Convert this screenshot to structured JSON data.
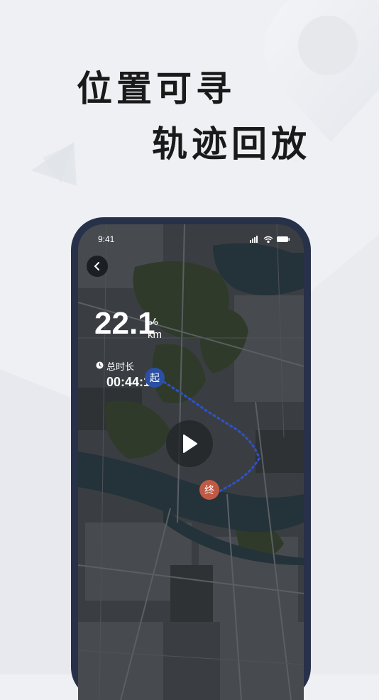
{
  "headline": {
    "line1": "位置可寻",
    "line2": "轨迹回放"
  },
  "status_bar": {
    "time": "9:41"
  },
  "trip": {
    "distance": "22.1",
    "distance_unit": "km",
    "duration_label": "总时长",
    "duration_value": "00:44:15"
  },
  "markers": {
    "start": "起",
    "end": "终"
  },
  "icons": {
    "back": "back-arrow-icon",
    "play": "play-icon",
    "scooter": "scooter-icon",
    "clock": "clock-icon",
    "signal": "signal-icon",
    "wifi": "wifi-icon",
    "battery": "battery-icon"
  },
  "colors": {
    "route": "#2e52c7",
    "start_marker": "#2b4fa3",
    "end_marker": "#c05a45",
    "phone_frame": "#273149",
    "background": "#eef0f4"
  }
}
